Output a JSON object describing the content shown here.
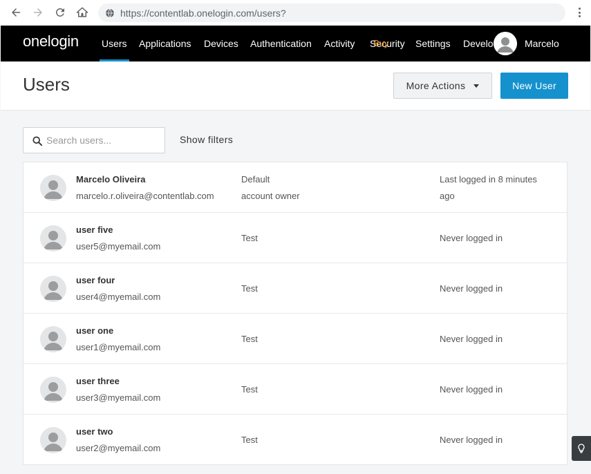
{
  "browser": {
    "url": "https://contentlab.onelogin.com/users?"
  },
  "navbar": {
    "logo": "onelogin",
    "items": [
      {
        "label": "Users"
      },
      {
        "label": "Applications"
      },
      {
        "label": "Devices"
      },
      {
        "label": "Authentication"
      },
      {
        "label": "Activity"
      },
      {
        "label": "Security"
      },
      {
        "label": "Settings"
      },
      {
        "label": "Developers"
      }
    ],
    "overlay_text": "Buy",
    "user_name": "Marcelo",
    "active_color": "#1591ce"
  },
  "header": {
    "title": "Users",
    "more_actions_label": "More Actions",
    "new_user_label": "New User",
    "accent_color": "#1591ce"
  },
  "search": {
    "placeholder": "Search users...",
    "show_filters_label": "Show filters"
  },
  "users": [
    {
      "name": "Marcelo Oliveira",
      "email": "marcelo.r.oliveira@contentlab.com",
      "role_line1": "Default",
      "role_line2": "account owner",
      "last_line1": "Last logged in 8 minutes",
      "last_line2": "ago"
    },
    {
      "name": "user five",
      "email": "user5@myemail.com",
      "role": "Test",
      "last": "Never logged in"
    },
    {
      "name": "user four",
      "email": "user4@myemail.com",
      "role": "Test",
      "last": "Never logged in"
    },
    {
      "name": "user one",
      "email": "user1@myemail.com",
      "role": "Test",
      "last": "Never logged in"
    },
    {
      "name": "user three",
      "email": "user3@myemail.com",
      "role": "Test",
      "last": "Never logged in"
    },
    {
      "name": "user two",
      "email": "user2@myemail.com",
      "role": "Test",
      "last": "Never logged in"
    }
  ]
}
